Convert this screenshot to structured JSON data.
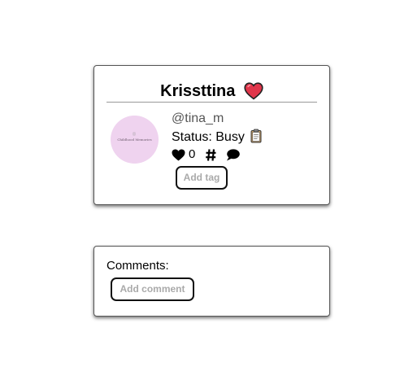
{
  "profile": {
    "name": "Krissttina",
    "name_icon": "heart-emoji-icon",
    "handle": "@tina_m",
    "status_text": "Status: Busy",
    "status_icon": "clipboard-icon",
    "avatar_caption": "Childhood Memories",
    "likes": "0",
    "like_icon": "heart-icon",
    "tag_icon": "hashtag-icon",
    "comment_icon": "comment-bubble-icon",
    "add_tag_label": "Add tag"
  },
  "comments": {
    "label": "Comments:",
    "add_comment_label": "Add comment"
  },
  "colors": {
    "avatar_bg": "#efd3ef",
    "heart_emoji": "#e0364b",
    "button_text": "#aaaaaa",
    "handle_text": "#555555"
  }
}
